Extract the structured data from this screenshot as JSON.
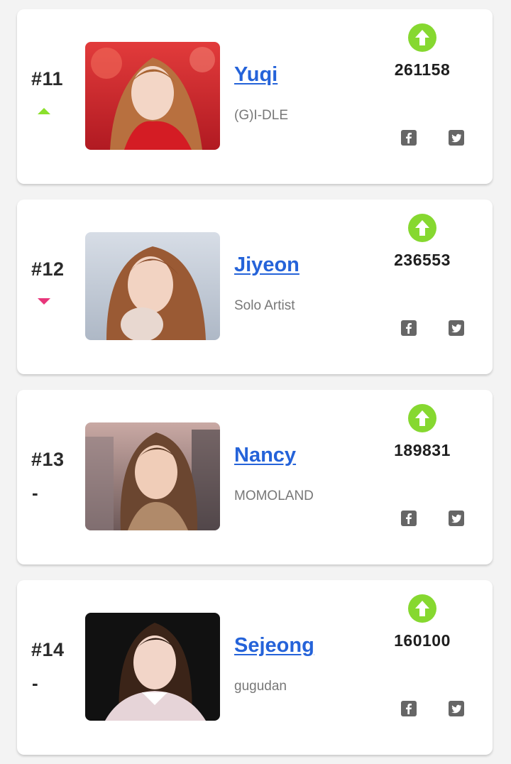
{
  "entries": [
    {
      "rank": "#11",
      "trend": "up",
      "trend_text": "",
      "name": "Yuqi",
      "group": "(G)I-DLE",
      "votes": "261158",
      "photo": {
        "bg_top": "#e23b3b",
        "bg_bottom": "#b11a22",
        "hair": "#b8703f",
        "clothes": "#d41c24",
        "skin": "#f3d6c6"
      }
    },
    {
      "rank": "#12",
      "trend": "down",
      "trend_text": "",
      "name": "Jiyeon",
      "group": "Solo Artist",
      "votes": "236553",
      "photo": {
        "bg_top": "#d7dde6",
        "bg_bottom": "#aeb8c6",
        "hair": "#9a5a34",
        "clothes": "#e8d8d0",
        "skin": "#f2d3c2"
      }
    },
    {
      "rank": "#13",
      "trend": "same",
      "trend_text": "-",
      "name": "Nancy",
      "group": "MOMOLAND",
      "votes": "189831",
      "photo": {
        "bg_top": "#c9a9a4",
        "bg_bottom": "#6e5a5a",
        "hair": "#6b4630",
        "clothes": "#b08a6a",
        "skin": "#f0cdb8"
      }
    },
    {
      "rank": "#14",
      "trend": "same",
      "trend_text": "-",
      "name": "Sejeong",
      "group": "gugudan",
      "votes": "160100",
      "photo": {
        "bg_top": "#111111",
        "bg_bottom": "#1c1c1c",
        "hair": "#3b2418",
        "clothes": "#e6d4d8",
        "skin": "#f2d5c8"
      }
    }
  ],
  "icons": {
    "vote": "arrow-up-circle-icon",
    "facebook": "facebook-icon",
    "twitter": "twitter-icon"
  },
  "colors": {
    "name_link": "#2563d9",
    "vote_button": "#86d830",
    "trend_up": "#8be02c",
    "trend_down": "#e8357a",
    "social": "#666666"
  }
}
